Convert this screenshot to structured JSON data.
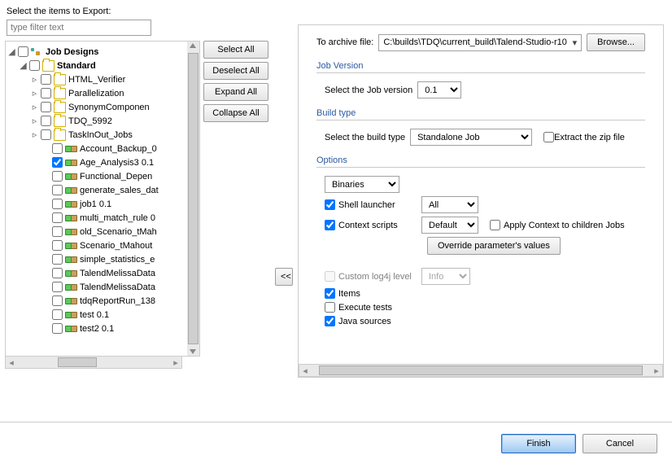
{
  "leftPanel": {
    "prompt": "Select the items to Export:",
    "filterPlaceholder": "type filter text"
  },
  "sideButtons": {
    "selectAll": "Select All",
    "deselectAll": "Deselect All",
    "expandAll": "Expand All",
    "collapseAll": "Collapse All"
  },
  "tree": {
    "root": "Job Designs",
    "standard": "Standard",
    "items": [
      {
        "label": "HTML_Verifier",
        "type": "folder",
        "expandable": true
      },
      {
        "label": "Parallelization",
        "type": "folder",
        "expandable": true
      },
      {
        "label": "SynonymComponen",
        "type": "folder",
        "expandable": true
      },
      {
        "label": "TDQ_5992",
        "type": "folder",
        "expandable": true
      },
      {
        "label": "TaskInOut_Jobs",
        "type": "folder",
        "expandable": true
      },
      {
        "label": "Account_Backup_0",
        "type": "job"
      },
      {
        "label": "Age_Analysis3 0.1",
        "type": "job",
        "checked": true
      },
      {
        "label": "Functional_Depen",
        "type": "job"
      },
      {
        "label": "generate_sales_dat",
        "type": "job"
      },
      {
        "label": "job1 0.1",
        "type": "job"
      },
      {
        "label": "multi_match_rule 0",
        "type": "job"
      },
      {
        "label": "old_Scenario_tMah",
        "type": "job"
      },
      {
        "label": "Scenario_tMahout",
        "type": "job"
      },
      {
        "label": "simple_statistics_e",
        "type": "job"
      },
      {
        "label": "TalendMelissaData",
        "type": "job"
      },
      {
        "label": "TalendMelissaData",
        "type": "job"
      },
      {
        "label": "tdqReportRun_138",
        "type": "job"
      },
      {
        "label": "test 0.1",
        "type": "job"
      },
      {
        "label": "test2 0.1",
        "type": "job"
      }
    ]
  },
  "midArrow": "<<",
  "right": {
    "archiveLabel": "To archive file:",
    "archivePath": "C:\\builds\\TDQ\\current_build\\Talend-Studio-r10",
    "browse": "Browse...",
    "jobVersionTitle": "Job Version",
    "jobVersionLabel": "Select the Job version",
    "jobVersionValue": "0.1",
    "buildTypeTitle": "Build type",
    "buildTypeLabel": "Select the build type",
    "buildTypeValue": "Standalone Job",
    "extractZip": "Extract the zip file",
    "optionsTitle": "Options",
    "binaries": "Binaries",
    "shellLauncher": "Shell launcher",
    "shellLauncherValue": "All",
    "contextScripts": "Context scripts",
    "contextScriptsValue": "Default",
    "applyContext": "Apply Context to children Jobs",
    "overrideParams": "Override parameter's values",
    "customLog4j": "Custom log4j level",
    "customLog4jValue": "Info",
    "items": "Items",
    "executeTests": "Execute tests",
    "javaSources": "Java sources"
  },
  "footer": {
    "finish": "Finish",
    "cancel": "Cancel"
  }
}
